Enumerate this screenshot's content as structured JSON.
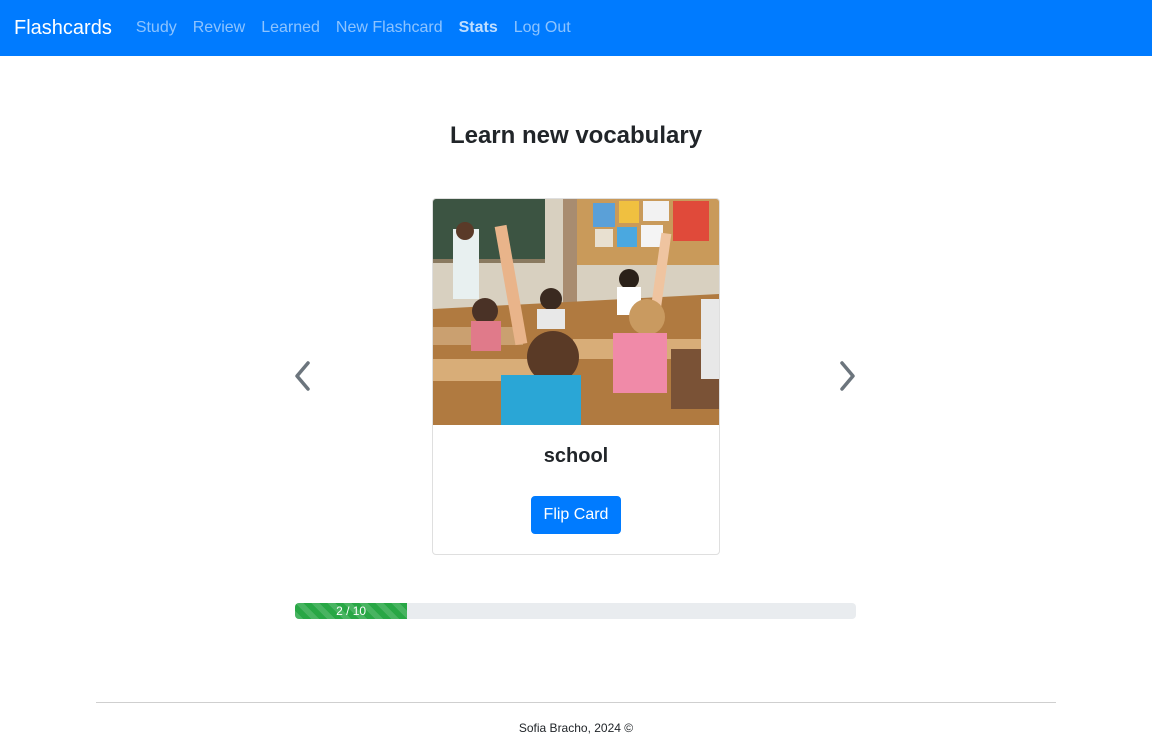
{
  "navbar": {
    "brand": "Flashcards",
    "links": [
      {
        "label": "Study",
        "active": false
      },
      {
        "label": "Review",
        "active": false
      },
      {
        "label": "Learned",
        "active": false
      },
      {
        "label": "New Flashcard",
        "active": false
      },
      {
        "label": "Stats",
        "active": true
      },
      {
        "label": "Log Out",
        "active": false
      }
    ],
    "color": "#007bff"
  },
  "main": {
    "title": "Learn new vocabulary",
    "card": {
      "image": "classroom-photo",
      "word": "school",
      "flip_label": "Flip Card"
    },
    "prev_icon": "chevron-left-icon",
    "next_icon": "chevron-right-icon"
  },
  "progress": {
    "label": "2 / 10",
    "current": 2,
    "total": 10,
    "color": "#28a745"
  },
  "footer": {
    "text": "Sofia Bracho, 2024 ©"
  }
}
